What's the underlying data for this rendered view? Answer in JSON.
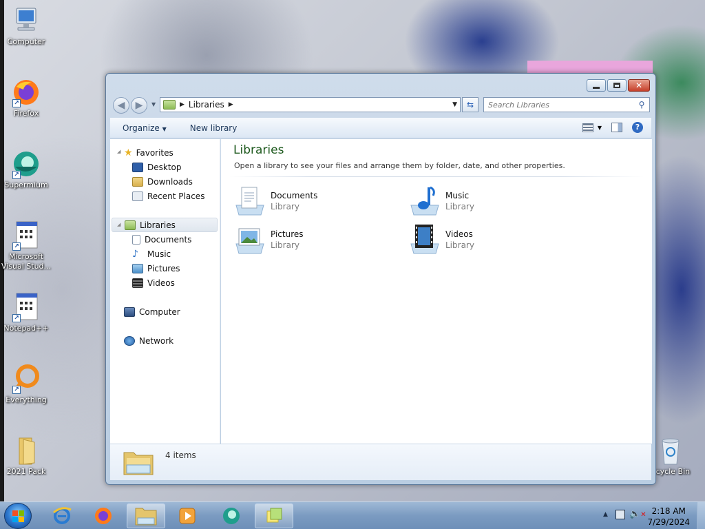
{
  "desktop": {
    "icons": [
      {
        "label": "Computer",
        "icon": "computer-icon"
      },
      {
        "label": "Firefox",
        "icon": "firefox-icon"
      },
      {
        "label": "Supermium",
        "icon": "supermium-icon"
      },
      {
        "label": "Microsoft Visual Stud...",
        "icon": "visual-studio-icon"
      },
      {
        "label": "Notepad++",
        "icon": "notepadpp-icon"
      },
      {
        "label": "Everything",
        "icon": "everything-icon"
      },
      {
        "label": "2021 Pack",
        "icon": "folder-icon"
      },
      {
        "label": "ecycle Bin",
        "icon": "recycle-bin-icon"
      }
    ]
  },
  "window": {
    "address": {
      "crumb": "Libraries"
    },
    "search": {
      "placeholder": "Search Libraries"
    },
    "toolbar": {
      "organize": "Organize",
      "new_library": "New library"
    },
    "nav": {
      "favorites": "Favorites",
      "desktop": "Desktop",
      "downloads": "Downloads",
      "recent": "Recent Places",
      "libraries": "Libraries",
      "documents": "Documents",
      "music": "Music",
      "pictures": "Pictures",
      "videos": "Videos",
      "computer": "Computer",
      "network": "Network"
    },
    "content": {
      "title": "Libraries",
      "subtitle": "Open a library to see your files and arrange them by folder, date, and other properties.",
      "libraries": [
        {
          "name": "Documents",
          "type": "Library"
        },
        {
          "name": "Music",
          "type": "Library"
        },
        {
          "name": "Pictures",
          "type": "Library"
        },
        {
          "name": "Videos",
          "type": "Library"
        }
      ]
    },
    "details": {
      "count": "4 items"
    }
  },
  "taskbar": {
    "clock": {
      "time": "2:18 AM",
      "date": "7/29/2024"
    },
    "buttons": [
      "internet-explorer-icon",
      "firefox-icon",
      "explorer-icon",
      "media-player-icon",
      "supermium-icon",
      "sticky-notes-icon"
    ]
  },
  "colors": {
    "title_green": "#1e5a1e",
    "taskbar": "#7b9bc1",
    "close_red": "#c6402a"
  }
}
